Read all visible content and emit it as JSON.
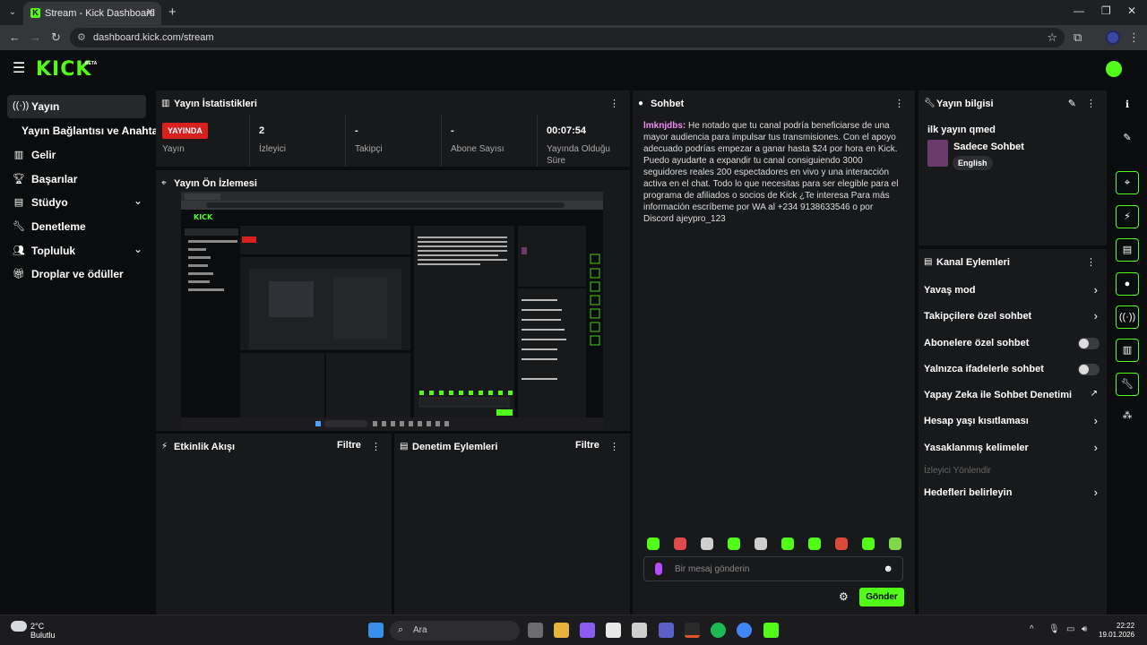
{
  "browser": {
    "tab_title": "Stream - Kick Dashboard",
    "url": "dashboard.kick.com/stream"
  },
  "header": {
    "logo": "KICK",
    "beta": "BETA"
  },
  "sidebar": {
    "items": [
      {
        "label": "Yayın",
        "icon": "broadcast-icon"
      },
      {
        "label": "Yayın Bağlantısı ve Anahtarı",
        "icon": ""
      },
      {
        "label": "Gelir",
        "icon": "revenue-icon"
      },
      {
        "label": "Başarılar",
        "icon": "trophy-icon"
      },
      {
        "label": "Stüdyo",
        "icon": "studio-icon"
      },
      {
        "label": "Denetleme",
        "icon": "wrench-icon"
      },
      {
        "label": "Topluluk",
        "icon": "community-icon"
      },
      {
        "label": "Droplar ve ödüller",
        "icon": "gift-icon"
      }
    ]
  },
  "stats": {
    "title": "Yayın İstatistikleri",
    "live_badge": "YAYINDA",
    "cells": [
      {
        "value": "",
        "label": "Yayın"
      },
      {
        "value": "2",
        "label": "İzleyici"
      },
      {
        "value": "-",
        "label": "Takipçi"
      },
      {
        "value": "-",
        "label": "Abone Sayısı"
      },
      {
        "value": "00:07:54",
        "label": "Yayında Olduğu Süre"
      }
    ]
  },
  "preview": {
    "title": "Yayın Ön İzlemesi"
  },
  "activity": {
    "title": "Etkinlik Akışı",
    "filter": "Filtre"
  },
  "moderation": {
    "title": "Denetim Eylemleri",
    "filter": "Filtre"
  },
  "chat": {
    "title": "Sohbet",
    "message_user": "lmknjdbs:",
    "message_text": " He notado que tu canal podría beneficiarse de una mayor audiencia para impulsar tus transmisiones. Con el apoyo adecuado podrías empezar a ganar hasta $24 por hora en Kick. Puedo ayudarte a expandir tu canal consiguiendo 3000 seguidores reales 200 espectadores en vivo y una interacción activa en el chat. Todo lo que necesitas para ser elegible para el programa de afiliados o socios de Kick ¿Te interesa Para más información escríbeme por WA al +234 9138633546 o por Discord ajeypro_123",
    "placeholder": "Bir mesaj gönderin",
    "send": "Gönder"
  },
  "stream_info": {
    "title": "Yayın bilgisi",
    "stream_title": "ilk yayın qmed",
    "category": "Sadece Sohbet",
    "language": "English"
  },
  "channel_actions": {
    "title": "Kanal Eylemleri",
    "rows": [
      {
        "label": "Yavaş mod",
        "control": "chevron"
      },
      {
        "label": "Takipçilere özel sohbet",
        "control": "chevron"
      },
      {
        "label": "Abonelere özel sohbet",
        "control": "toggle"
      },
      {
        "label": "Yalnızca ifadelerle sohbet",
        "control": "toggle"
      },
      {
        "label": "Yapay Zeka ile Sohbet Denetimi",
        "control": "external"
      },
      {
        "label": "Hesap yaşı kısıtlaması",
        "control": "chevron"
      },
      {
        "label": "Yasaklanmış kelimeler",
        "control": "chevron"
      },
      {
        "label": "İzleyici Yönlendir",
        "control": "none"
      },
      {
        "label": "Hedefleri belirleyin",
        "control": "chevron"
      }
    ]
  },
  "taskbar": {
    "temperature": "2°C",
    "weather": "Bulutlu",
    "search": "Ara",
    "time": "22:22",
    "date": "19.01.2026"
  },
  "colors": {
    "accent": "#53fc18",
    "live": "#d8201f",
    "panel": "#18191b",
    "bg": "#0b0c0d"
  }
}
